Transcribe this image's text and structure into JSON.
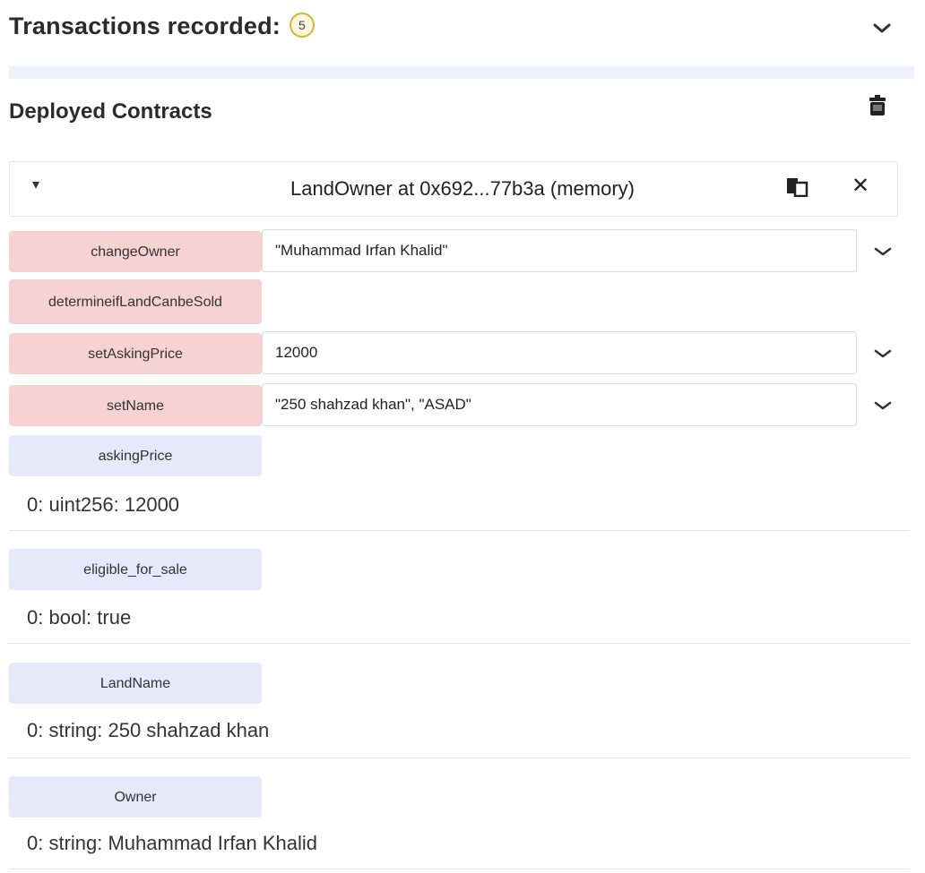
{
  "transactions": {
    "label": "Transactions recorded:",
    "count": "5"
  },
  "deployed": {
    "title": "Deployed Contracts"
  },
  "instance": {
    "label": "LandOwner at 0x692...77b3a (memory)"
  },
  "functions": [
    {
      "name": "changeOwner",
      "value": "\"Muhammad Irfan Khalid\""
    },
    {
      "name": "determineifLandCanbeSold"
    },
    {
      "name": "setAskingPrice",
      "value": "12000"
    },
    {
      "name": "setName",
      "value": "\"250 shahzad khan\", \"ASAD\""
    }
  ],
  "getters": [
    {
      "name": "askingPrice",
      "result": "0: uint256: 12000"
    },
    {
      "name": "eligible_for_sale",
      "result": "0: bool: true"
    },
    {
      "name": "LandName",
      "result": "0: string: 250 shahzad khan"
    },
    {
      "name": "Owner",
      "result": "0: string: Muhammad Irfan Khalid"
    }
  ],
  "icons": {
    "expand": "chevron-down-icon",
    "clear": "trash-icon",
    "copy": "copy-icon",
    "close": "close-icon",
    "caret": "caret-down-icon"
  },
  "colors": {
    "transact_button": "#f7d2d2",
    "call_button": "#e6e9f9",
    "badge_border": "#d9b23a"
  }
}
